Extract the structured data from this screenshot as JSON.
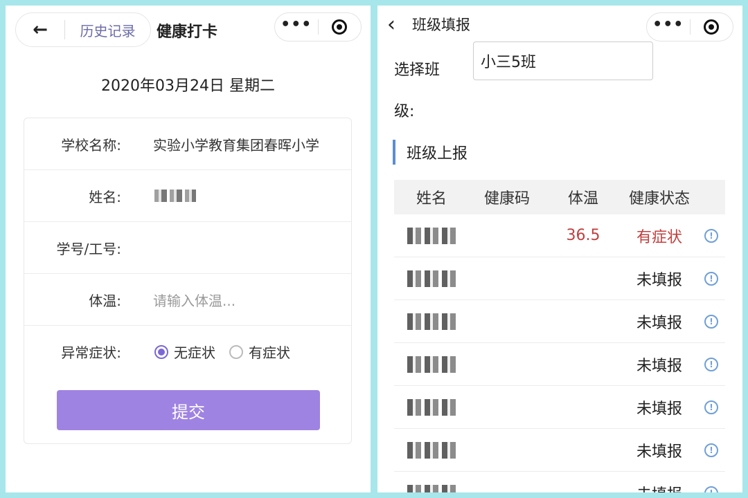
{
  "left": {
    "history_label": "历史记录",
    "title": "健康打卡",
    "date_text": "2020年03月24日 星期二",
    "form": {
      "school_label": "学校名称:",
      "school_value": "实验小学教育集团春晖小学",
      "name_label": "姓名:",
      "id_label": "学号/工号:",
      "temp_label": "体温:",
      "temp_placeholder": "请输入体温...",
      "symptom_label": "异常症状:",
      "symptom_options": [
        "无症状",
        "有症状"
      ],
      "symptom_selected": "无症状"
    },
    "submit_label": "提交"
  },
  "right": {
    "title": "班级填报",
    "class_label": "选择班级:",
    "class_value": "小三5班",
    "section_title": "班级上报",
    "table": {
      "headers": [
        "姓名",
        "健康码",
        "体温",
        "健康状态"
      ],
      "rows": [
        {
          "temp": "36.5",
          "status": "有症状"
        },
        {
          "temp": "",
          "status": "未填报"
        },
        {
          "temp": "",
          "status": "未填报"
        },
        {
          "temp": "",
          "status": "未填报"
        },
        {
          "temp": "",
          "status": "未填报"
        },
        {
          "temp": "",
          "status": "未填报"
        },
        {
          "temp": "",
          "status": "未填报"
        }
      ]
    }
  },
  "colors": {
    "accent_purple": "#9f83e2",
    "radio_purple": "#7b68d4",
    "alert_red": "#c0403e",
    "section_blue": "#5b8ed1",
    "background_teal": "#a7e6ea"
  },
  "icons": [
    "back-arrow-icon",
    "more-dots-icon",
    "target-icon",
    "chevron-left-icon",
    "info-icon"
  ]
}
